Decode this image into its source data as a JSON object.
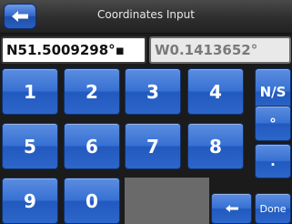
{
  "header": {
    "title": "Coordinates Input",
    "back_icon": "left-arrow-icon"
  },
  "inputs": {
    "latitude": "N51.5009298°▪",
    "longitude": "W0.1413652°"
  },
  "keypad": {
    "digits": [
      "1",
      "2",
      "3",
      "4",
      "5",
      "6",
      "7",
      "8",
      "9",
      "0"
    ],
    "ns_label": "N/S",
    "degree_label": "°",
    "dot_label": ".",
    "backspace_icon": "backspace-arrow-icon",
    "done_label": "Done"
  },
  "colors": {
    "key_blue": "#3771d3",
    "titlebar": "#2e2e2e",
    "background": "#1b1b1b"
  }
}
